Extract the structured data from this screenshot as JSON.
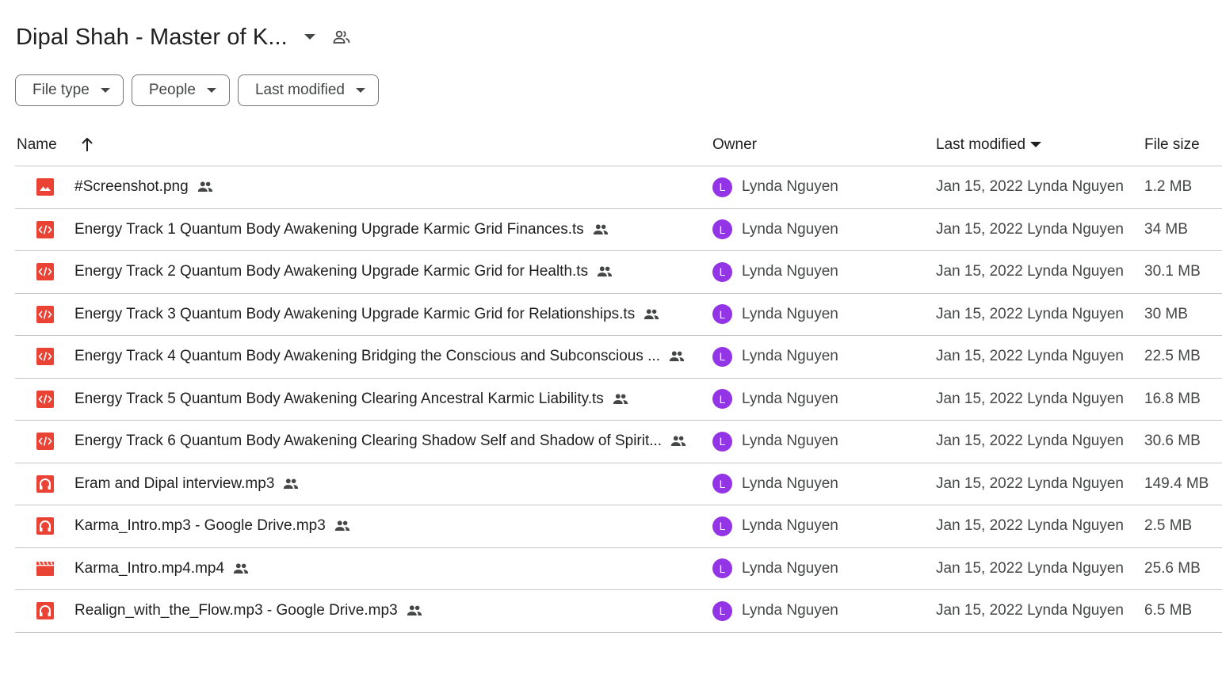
{
  "folder": {
    "title": "Dipal Shah - Master of K...",
    "title_caret_icon": "arrow-drop-down-icon",
    "shared_icon": "shared-folder-people-icon"
  },
  "filters": [
    {
      "label": "File type"
    },
    {
      "label": "People"
    },
    {
      "label": "Last modified"
    }
  ],
  "columns": {
    "name": "Name",
    "owner": "Owner",
    "last_modified": "Last modified",
    "file_size": "File size"
  },
  "colors": {
    "file_icon_red": "#ea4335",
    "avatar_purple": "#9334e6"
  },
  "files": [
    {
      "name": "#Screenshot.png",
      "icon": "image-file-icon",
      "owner": "Lynda Nguyen",
      "owner_initial": "L",
      "modified": "Jan 15, 2022 Lynda Nguyen",
      "size": "1.2 MB"
    },
    {
      "name": "Energy Track 1 Quantum Body Awakening Upgrade Karmic Grid Finances.ts",
      "icon": "code-file-icon",
      "owner": "Lynda Nguyen",
      "owner_initial": "L",
      "modified": "Jan 15, 2022 Lynda Nguyen",
      "size": "34 MB"
    },
    {
      "name": "Energy Track 2 Quantum Body Awakening Upgrade Karmic Grid for Health.ts",
      "icon": "code-file-icon",
      "owner": "Lynda Nguyen",
      "owner_initial": "L",
      "modified": "Jan 15, 2022 Lynda Nguyen",
      "size": "30.1 MB"
    },
    {
      "name": "Energy Track 3 Quantum Body Awakening Upgrade Karmic Grid for Relationships.ts",
      "icon": "code-file-icon",
      "owner": "Lynda Nguyen",
      "owner_initial": "L",
      "modified": "Jan 15, 2022 Lynda Nguyen",
      "size": "30 MB"
    },
    {
      "name": "Energy Track 4 Quantum Body Awakening Bridging the Conscious and Subconscious ...",
      "icon": "code-file-icon",
      "owner": "Lynda Nguyen",
      "owner_initial": "L",
      "modified": "Jan 15, 2022 Lynda Nguyen",
      "size": "22.5 MB"
    },
    {
      "name": "Energy Track 5 Quantum Body Awakening Clearing Ancestral Karmic Liability.ts",
      "icon": "code-file-icon",
      "owner": "Lynda Nguyen",
      "owner_initial": "L",
      "modified": "Jan 15, 2022 Lynda Nguyen",
      "size": "16.8 MB"
    },
    {
      "name": "Energy Track 6 Quantum Body Awakening Clearing Shadow Self and Shadow of Spirit...",
      "icon": "code-file-icon",
      "owner": "Lynda Nguyen",
      "owner_initial": "L",
      "modified": "Jan 15, 2022 Lynda Nguyen",
      "size": "30.6 MB"
    },
    {
      "name": "Eram and Dipal interview.mp3",
      "icon": "audio-file-icon",
      "owner": "Lynda Nguyen",
      "owner_initial": "L",
      "modified": "Jan 15, 2022 Lynda Nguyen",
      "size": "149.4 MB"
    },
    {
      "name": "Karma_Intro.mp3 - Google Drive.mp3",
      "icon": "audio-file-icon",
      "owner": "Lynda Nguyen",
      "owner_initial": "L",
      "modified": "Jan 15, 2022 Lynda Nguyen",
      "size": "2.5 MB"
    },
    {
      "name": "Karma_Intro.mp4.mp4",
      "icon": "video-file-icon",
      "owner": "Lynda Nguyen",
      "owner_initial": "L",
      "modified": "Jan 15, 2022 Lynda Nguyen",
      "size": "25.6 MB"
    },
    {
      "name": "Realign_with_the_Flow.mp3 - Google Drive.mp3",
      "icon": "audio-file-icon",
      "owner": "Lynda Nguyen",
      "owner_initial": "L",
      "modified": "Jan 15, 2022 Lynda Nguyen",
      "size": "6.5 MB"
    }
  ]
}
